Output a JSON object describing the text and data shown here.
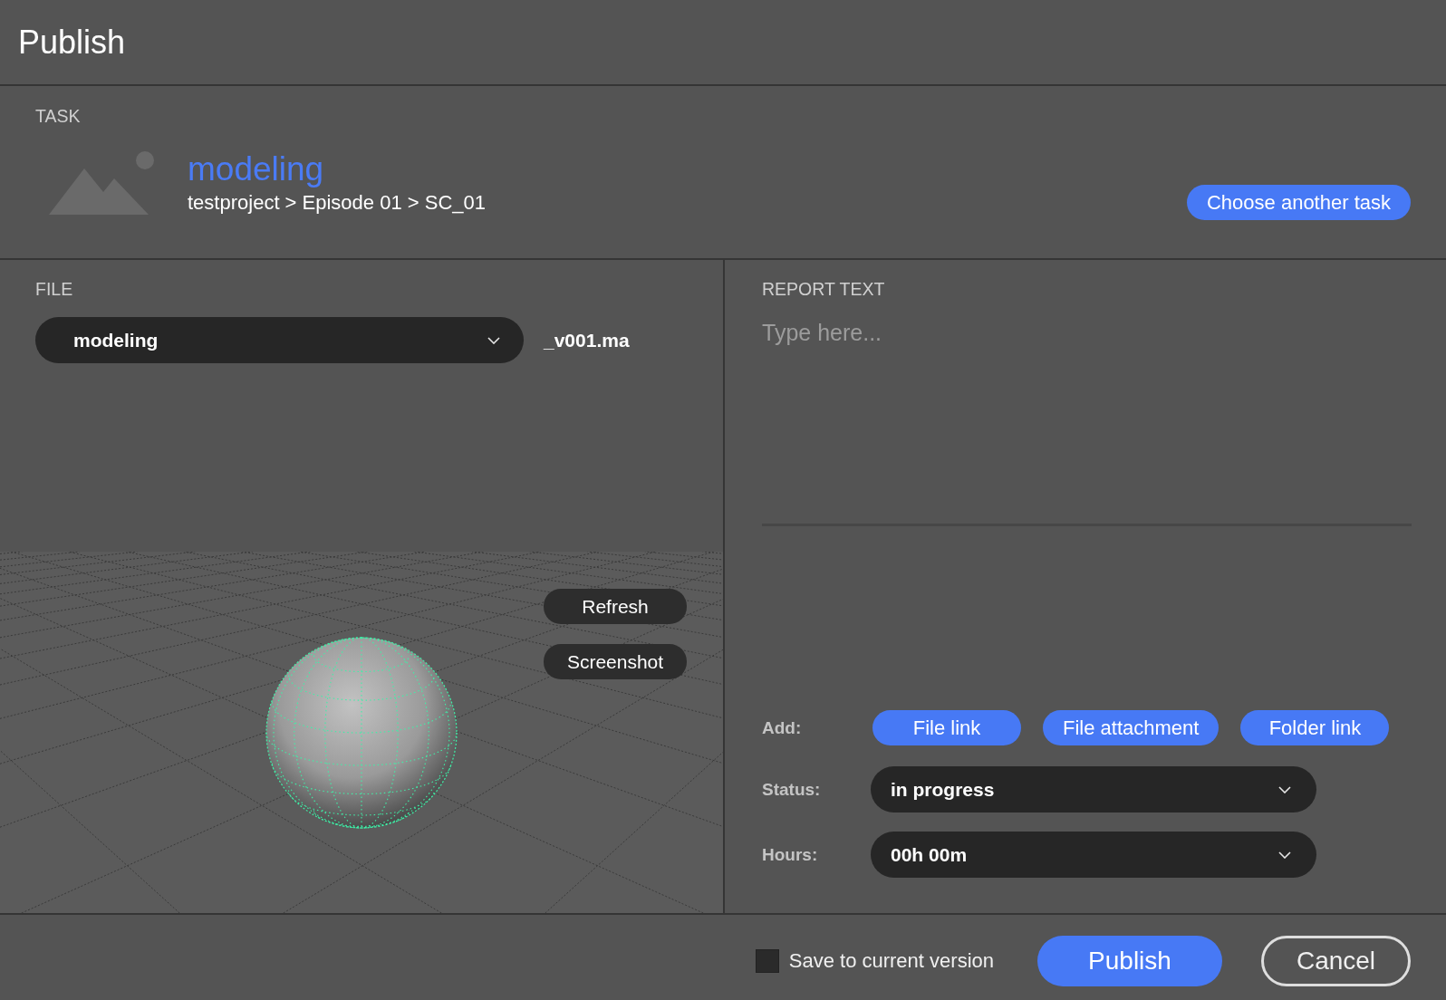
{
  "window": {
    "title": "Publish"
  },
  "task": {
    "label": "TASK",
    "name": "modeling",
    "path": "testproject > Episode 01 > SC_01",
    "change_button": "Choose another task"
  },
  "file": {
    "label": "FILE",
    "dropdown": "modeling",
    "suffix": "_v001.ma",
    "preview_buttons": [
      "Refresh",
      "Screenshot"
    ]
  },
  "report": {
    "label": "REPORT TEXT",
    "placeholder": "Type here..."
  },
  "add": {
    "label": "Add:",
    "buttons": [
      "File link",
      "File attachment",
      "Folder link"
    ]
  },
  "fields": [
    {
      "label": "Status:",
      "value": "in progress"
    },
    {
      "label": "Hours:",
      "value": "00h 00m"
    }
  ],
  "footer": {
    "save_option": {
      "label": "Save to current version",
      "checked": false
    },
    "buttons": [
      {
        "label": "Publish",
        "kind": "primary"
      },
      {
        "label": "Cancel",
        "kind": "outline"
      }
    ]
  }
}
